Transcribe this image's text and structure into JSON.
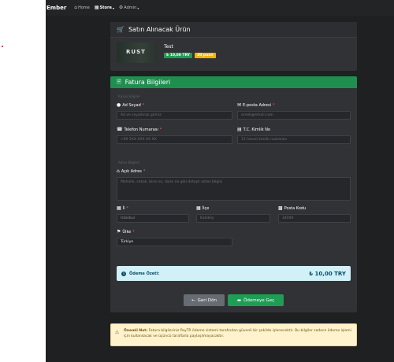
{
  "navbar": {
    "brand": "Ember",
    "items": [
      {
        "label": "Home",
        "icon": "home-icon"
      },
      {
        "label": "Store",
        "icon": "store-icon"
      },
      {
        "label": "Admin",
        "icon": "admin-icon"
      }
    ]
  },
  "order": {
    "title": "Satın Alınacak Ürün",
    "product_name": "Test",
    "thumbnail_text": "RUST",
    "price_badge": "₺ 10,00 TRY",
    "points_badge": "20 puan"
  },
  "billing": {
    "title": "Fatura Bilgileri",
    "personal_section": "Kişisel Bilgiler",
    "address_section": "Adres Bilgileri",
    "fields": {
      "name": {
        "label": "Ad Soyad",
        "placeholder": "Ad ve soyadınızı giriniz"
      },
      "email": {
        "label": "E-posta Adresi",
        "placeholder": "ornek@email.com"
      },
      "phone": {
        "label": "Telefon Numarası",
        "placeholder": "+90 5XX XXX XX XX"
      },
      "tc": {
        "label": "T.C. Kimlik No",
        "placeholder": "11 haneli kimlik numarası"
      },
      "address": {
        "label": "Açık Adres",
        "placeholder": "Mahalle, sokak, bina no, daire no gibi detaylı adres bilgisi"
      },
      "city": {
        "label": "İl",
        "value": "İstanbul"
      },
      "district": {
        "label": "İlçe",
        "value": "Kadıköy"
      },
      "postal": {
        "label": "Posta Kodu",
        "value": "34000"
      },
      "country": {
        "label": "Ülke",
        "value": "Türkiye"
      }
    },
    "summary_label": "Ödeme Özeti:",
    "summary_value": "₺ 10,00 TRY",
    "back_button": "Geri Dön",
    "pay_button": "Ödemeye Geç"
  },
  "notice": {
    "title": "Önemli Not:",
    "text": "Fatura bilgileriniz PayTR ödeme sistemi tarafından güvenli bir şekilde işlenecektir. Bu bilgiler sadece ödeme işlemi için kullanılacak ve üçüncü taraflarla paylaşılmayacaktır."
  },
  "colors": {
    "page_bg": "#1e2022",
    "card_bg": "#303235",
    "accent_green": "#1f9d55",
    "summary_bg": "#d1f0f8",
    "notice_bg": "#fff3cd"
  }
}
